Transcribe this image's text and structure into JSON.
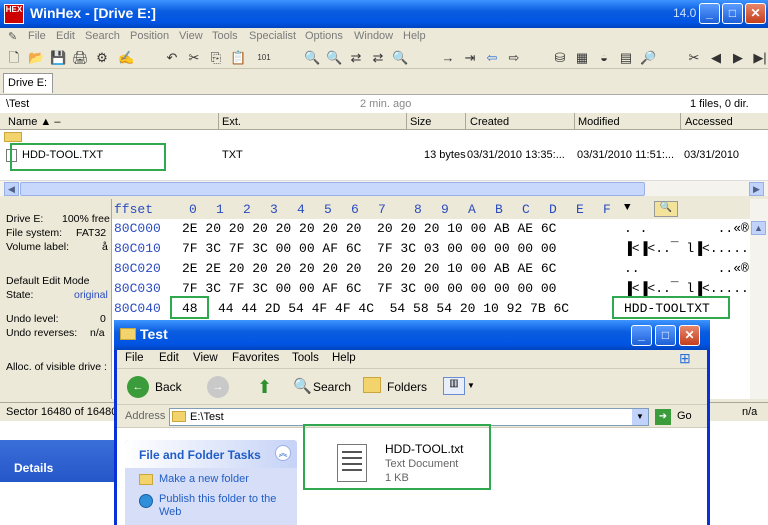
{
  "app": {
    "logo_text": "HEX",
    "title": "WinHex - [Drive E:]",
    "version": "14.0"
  },
  "menu": [
    "File",
    "Edit",
    "Search",
    "Position",
    "View",
    "Tools",
    "Specialist",
    "Options",
    "Window",
    "Help"
  ],
  "tab": {
    "label": "Drive E:"
  },
  "path": {
    "current": "\\Test",
    "age": "2 min. ago",
    "count": "1 files, 0 dir."
  },
  "file_list": {
    "columns": [
      "Name ▲ –",
      "Ext.",
      "Size",
      "Created",
      "Modified",
      "Accessed"
    ],
    "rows": [
      {
        "name": "HDD-TOOL.TXT",
        "ext": "TXT",
        "size": "13 bytes",
        "created": "03/31/2010  13:35:...",
        "modified": "03/31/2010  11:51:...",
        "accessed": "03/31/2010"
      }
    ]
  },
  "drive_info": {
    "drive_label": "Drive E:",
    "drive_value": "100% free",
    "fs_label": "File system:",
    "fs_value": "FAT32",
    "vol_label": "Volume label:",
    "vol_value": "å",
    "edit_mode_label": "Default Edit Mode",
    "state_label": "State:",
    "state_value": "original",
    "undo_level_label": "Undo level:",
    "undo_level_value": "0",
    "undo_rev_label": "Undo reverses:",
    "undo_rev_value": "n/a",
    "alloc_label": "Alloc. of visible drive :"
  },
  "hex": {
    "offset_header": "ffset",
    "columns": [
      "0",
      "1",
      "2",
      "3",
      "4",
      "5",
      "6",
      "7",
      "8",
      "9",
      "A",
      "B",
      "C",
      "D",
      "E",
      "F"
    ],
    "rows": [
      {
        "offset": "80C000",
        "bytes": "2E 20 20 20 20 20 20 20  20 20 20 10 00 AB AE 6C",
        "ascii": ". .         ..«®"
      },
      {
        "offset": "80C010",
        "bytes": "7F 3C 7F 3C 00 00 AF 6C  7F 3C 03 00 00 00 00 00",
        "ascii": "▐<▐<..¯ l▐<......"
      },
      {
        "offset": "80C020",
        "bytes": "2E 2E 20 20 20 20 20 20  20 20 20 10 00 AB AE 6C",
        "ascii": "..          ..«®"
      },
      {
        "offset": "80C030",
        "bytes": "7F 3C 7F 3C 00 00 AF 6C  7F 3C 00 00 00 00 00 00",
        "ascii": "▐<▐<..¯ l▐<......"
      },
      {
        "offset": "80C040",
        "first_byte": "48",
        "bytes": "44 44 2D 54 4F 4F 4C  54 58 54 20 10 92 7B 6C",
        "ascii": "HDD-TOOLTXT"
      }
    ]
  },
  "status": {
    "sector": "Sector 16480 of 16480",
    "right": "n/a"
  },
  "left_pane": {
    "details": "Details"
  },
  "explorer": {
    "title": "Test",
    "menu": [
      "File",
      "Edit",
      "View",
      "Favorites",
      "Tools",
      "Help"
    ],
    "toolbar": {
      "back": "Back",
      "search": "Search",
      "folders": "Folders"
    },
    "address_label": "Address",
    "address_value": "E:\\Test",
    "go_label": "Go",
    "tasks_title": "File and Folder Tasks",
    "tasks": [
      "Make a new folder",
      "Publish this folder to the Web"
    ],
    "file": {
      "name": "HDD-TOOL.txt",
      "type": "Text Document",
      "size": "1 KB"
    }
  },
  "colors": {
    "titlebar": "#0054e3",
    "highlight": "#2fa84f",
    "hex_offset": "#2b4cc0"
  }
}
